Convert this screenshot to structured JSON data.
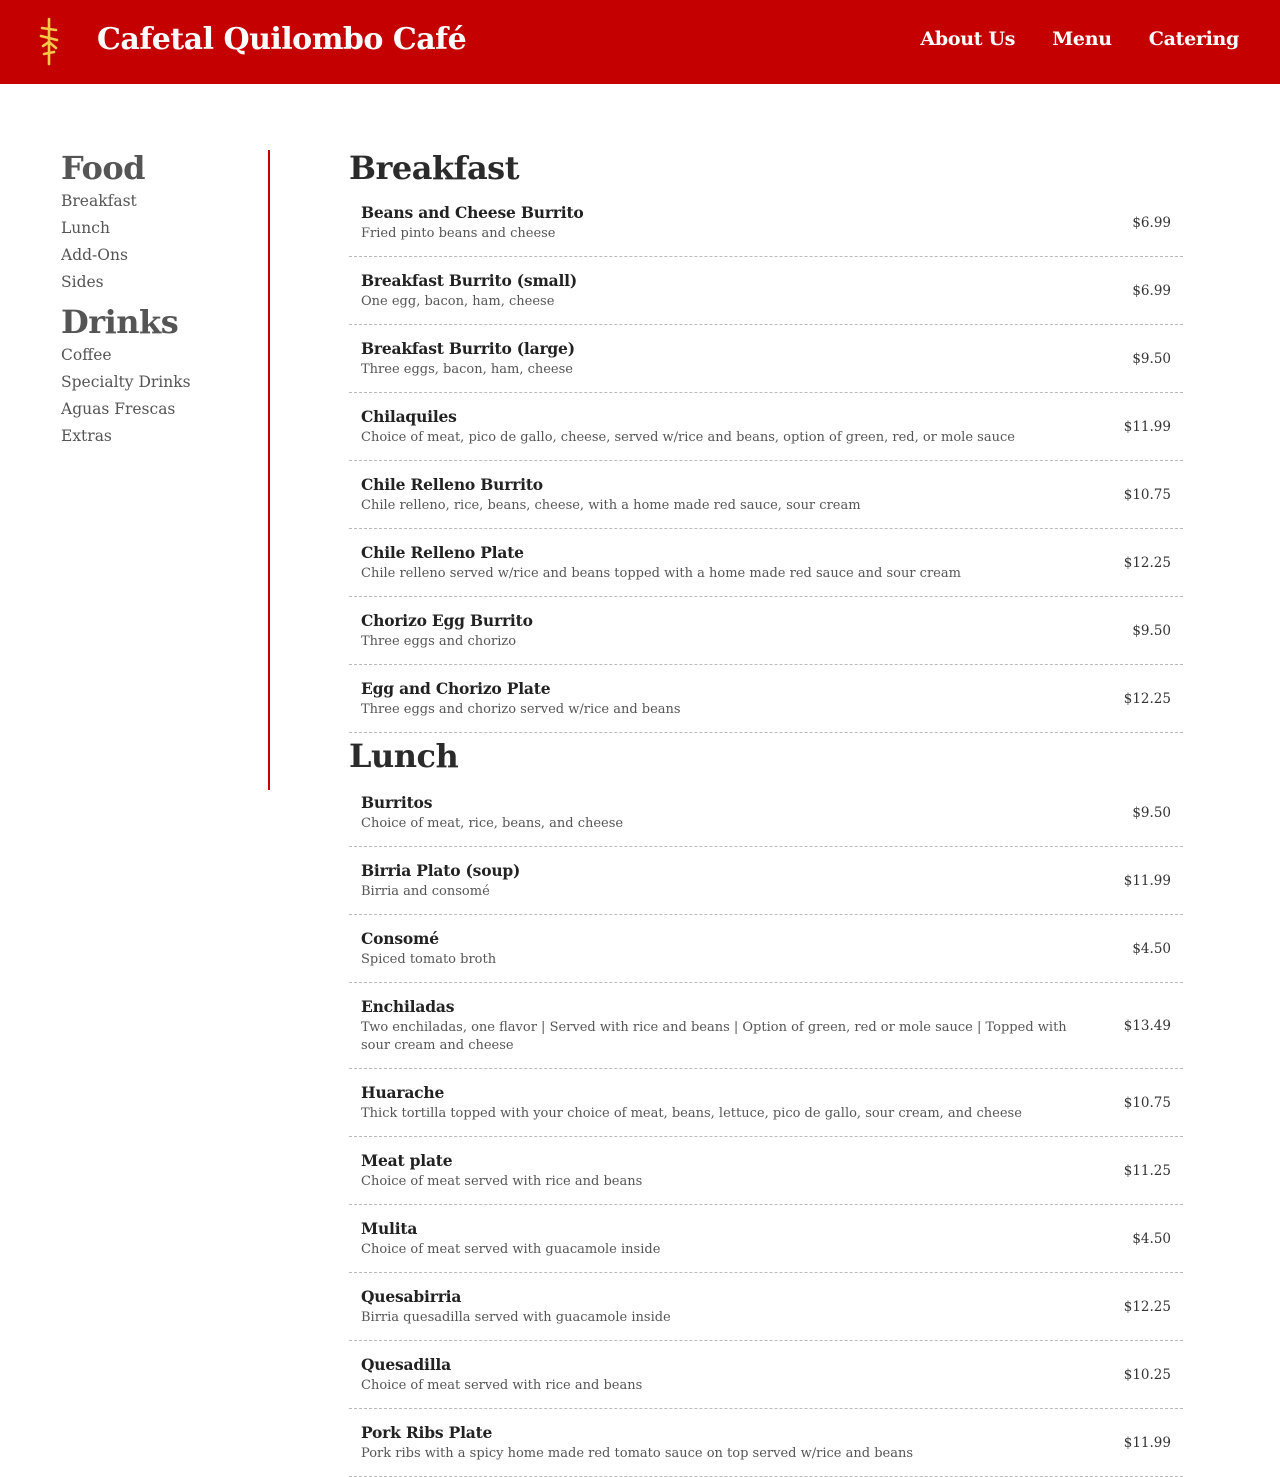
{
  "header": {
    "title": "Cafetal Quilombo Café",
    "logo_color": "#f6c94a",
    "bg_color": "#c40000",
    "nav": [
      "About Us",
      "Menu",
      "Catering"
    ]
  },
  "sidebar": {
    "food_heading": "Food",
    "food_items": [
      "Breakfast",
      "Lunch",
      "Add-Ons",
      "Sides"
    ],
    "drinks_heading": "Drinks",
    "drinks_items": [
      "Coffee",
      "Specialty Drinks",
      "Aguas Frescas",
      "Extras"
    ]
  },
  "menu": {
    "breakfast": {
      "title": "Breakfast",
      "items": [
        {
          "name": "Beans and Cheese Burrito",
          "desc": "Fried pinto beans and cheese",
          "price": "$6.99"
        },
        {
          "name": "Breakfast Burrito (small)",
          "desc": "One egg, bacon, ham, cheese",
          "price": "$6.99"
        },
        {
          "name": "Breakfast Burrito (large)",
          "desc": "Three eggs, bacon, ham, cheese",
          "price": "$9.50"
        },
        {
          "name": "Chilaquiles",
          "desc": "Choice of meat, pico de gallo, cheese, served w/rice and beans, option of green, red, or mole sauce",
          "price": "$11.99"
        },
        {
          "name": "Chile Relleno Burrito",
          "desc": "Chile relleno, rice, beans, cheese, with a home made red sauce, sour cream",
          "price": "$10.75"
        },
        {
          "name": "Chile Relleno Plate",
          "desc": "Chile relleno served w/rice and beans topped with a home made red sauce and sour cream",
          "price": "$12.25"
        },
        {
          "name": "Chorizo Egg Burrito",
          "desc": "Three eggs and chorizo",
          "price": "$9.50"
        },
        {
          "name": "Egg and Chorizo Plate",
          "desc": "Three eggs and chorizo served w/rice and beans",
          "price": "$12.25"
        }
      ]
    },
    "lunch": {
      "title": "Lunch",
      "items": [
        {
          "name": "Burritos",
          "desc": "Choice of meat, rice, beans, and cheese",
          "price": "$9.50"
        },
        {
          "name": "Birria Plato (soup)",
          "desc": "Birria and consomé",
          "price": "$11.99"
        },
        {
          "name": "Consomé",
          "desc": "Spiced tomato broth",
          "price": "$4.50"
        },
        {
          "name": "Enchiladas",
          "desc": "Two enchiladas, one flavor | Served with rice and beans | Option of green, red or mole sauce | Topped with sour cream and cheese",
          "price": "$13.49"
        },
        {
          "name": "Huarache",
          "desc": "Thick tortilla topped with your choice of meat, beans, lettuce, pico de gallo, sour cream, and cheese",
          "price": "$10.75"
        },
        {
          "name": "Meat plate",
          "desc": "Choice of meat served with rice and beans",
          "price": "$11.25"
        },
        {
          "name": "Mulita",
          "desc": "Choice of meat served with guacamole inside",
          "price": "$4.50"
        },
        {
          "name": "Quesabirria",
          "desc": "Birria quesadilla served with guacamole inside",
          "price": "$12.25"
        },
        {
          "name": "Quesadilla",
          "desc": "Choice of meat served with rice and beans",
          "price": "$10.25"
        },
        {
          "name": "Pork Ribs Plate",
          "desc": "Pork ribs with a spicy home made red tomato sauce on top served w/rice and beans",
          "price": "$11.99"
        }
      ]
    }
  }
}
